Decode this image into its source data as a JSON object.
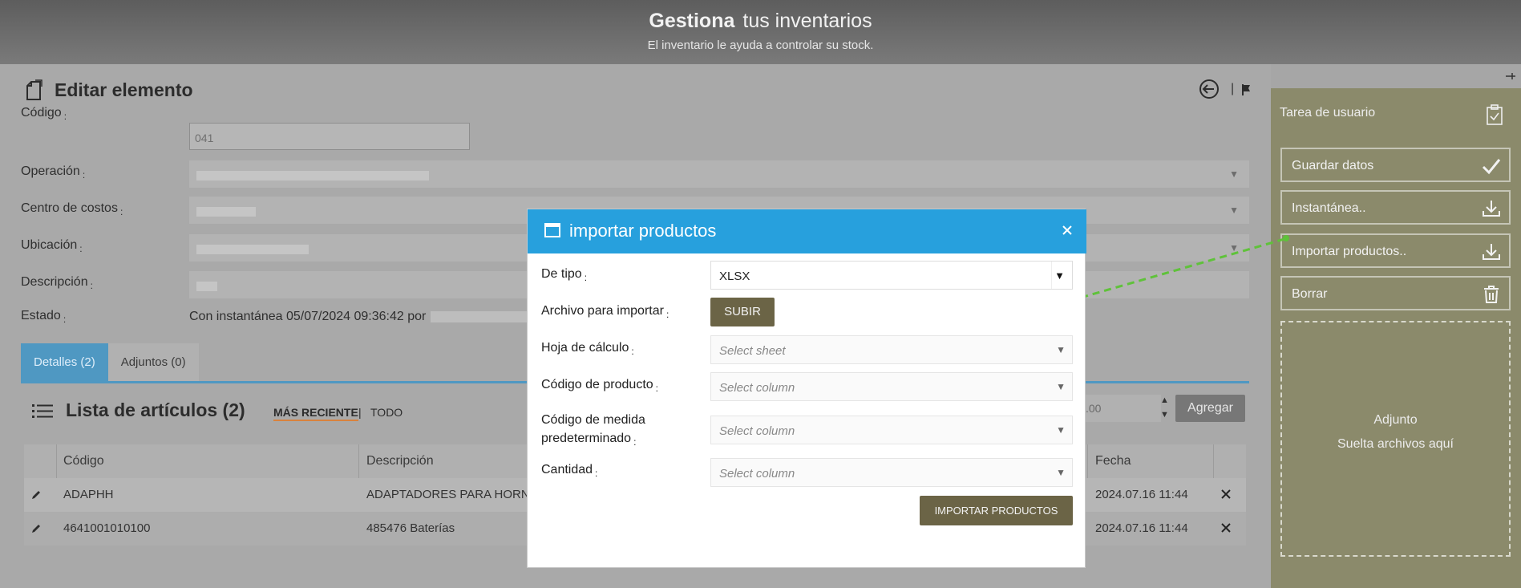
{
  "header": {
    "title_bold": "Gestiona",
    "title_rest": "tus inventarios",
    "subtitle": "El inventario le ayuda a controlar su stock."
  },
  "edit": {
    "title": "Editar elemento",
    "labels": {
      "codigo": "Código",
      "operacion": "Operación",
      "centro": "Centro de costos",
      "ubicacion": "Ubicación",
      "descripcion": "Descripción",
      "estado": "Estado"
    },
    "colon": ":",
    "codigo_value": "041",
    "estado_value": "Con instantánea 05/07/2024 09:36:42 por"
  },
  "tabs": [
    {
      "label": "Detalles (2)"
    },
    {
      "label": "Adjuntos (0)"
    }
  ],
  "list": {
    "title": "Lista de artículos (2)",
    "filter_recent": "MÁS RECIENTE",
    "filter_sep": "|",
    "filter_all": "TODO",
    "qty_value": ".00",
    "add_label": "Agregar"
  },
  "table": {
    "headers": {
      "codigo": "Código",
      "descripcion": "Descripción",
      "fecha": "Fecha"
    },
    "rows": [
      {
        "codigo": "ADAPHH",
        "descripcion": "ADAPTADORES PARA HORNE",
        "fecha": "2024.07.16 11:44"
      },
      {
        "codigo": "4641001010100",
        "descripcion": "485476 Baterías",
        "fecha": "2024.07.16 11:44"
      }
    ]
  },
  "right": {
    "task_title": "Tarea de usuario",
    "buttons": {
      "save": "Guardar datos",
      "snapshot": "Instantánea..",
      "import": "Importar productos..",
      "delete": "Borrar"
    },
    "drop_title": "Adjunto",
    "drop_hint": "Suelta archivos aquí"
  },
  "modal": {
    "title": "importar productos",
    "labels": {
      "tipo": "De tipo",
      "archivo": "Archivo para importar",
      "hoja": "Hoja de cálculo",
      "codigo_producto": "Código de producto",
      "codigo_medida_1": "Código de medida",
      "codigo_medida_2": "predeterminado",
      "cantidad": "Cantidad"
    },
    "tipo_value": "XLSX",
    "upload_label": "SUBIR",
    "placeholders": {
      "sheet": "Select sheet",
      "column": "Select column"
    },
    "import_label": "IMPORTAR PRODUCTOS"
  },
  "colors": {
    "modal_header": "#27a0dd",
    "olive_button": "#6b6446",
    "tab_active": "#4f98c2",
    "right_panel": "#8b8a6b",
    "arrow": "#5fc23a"
  }
}
